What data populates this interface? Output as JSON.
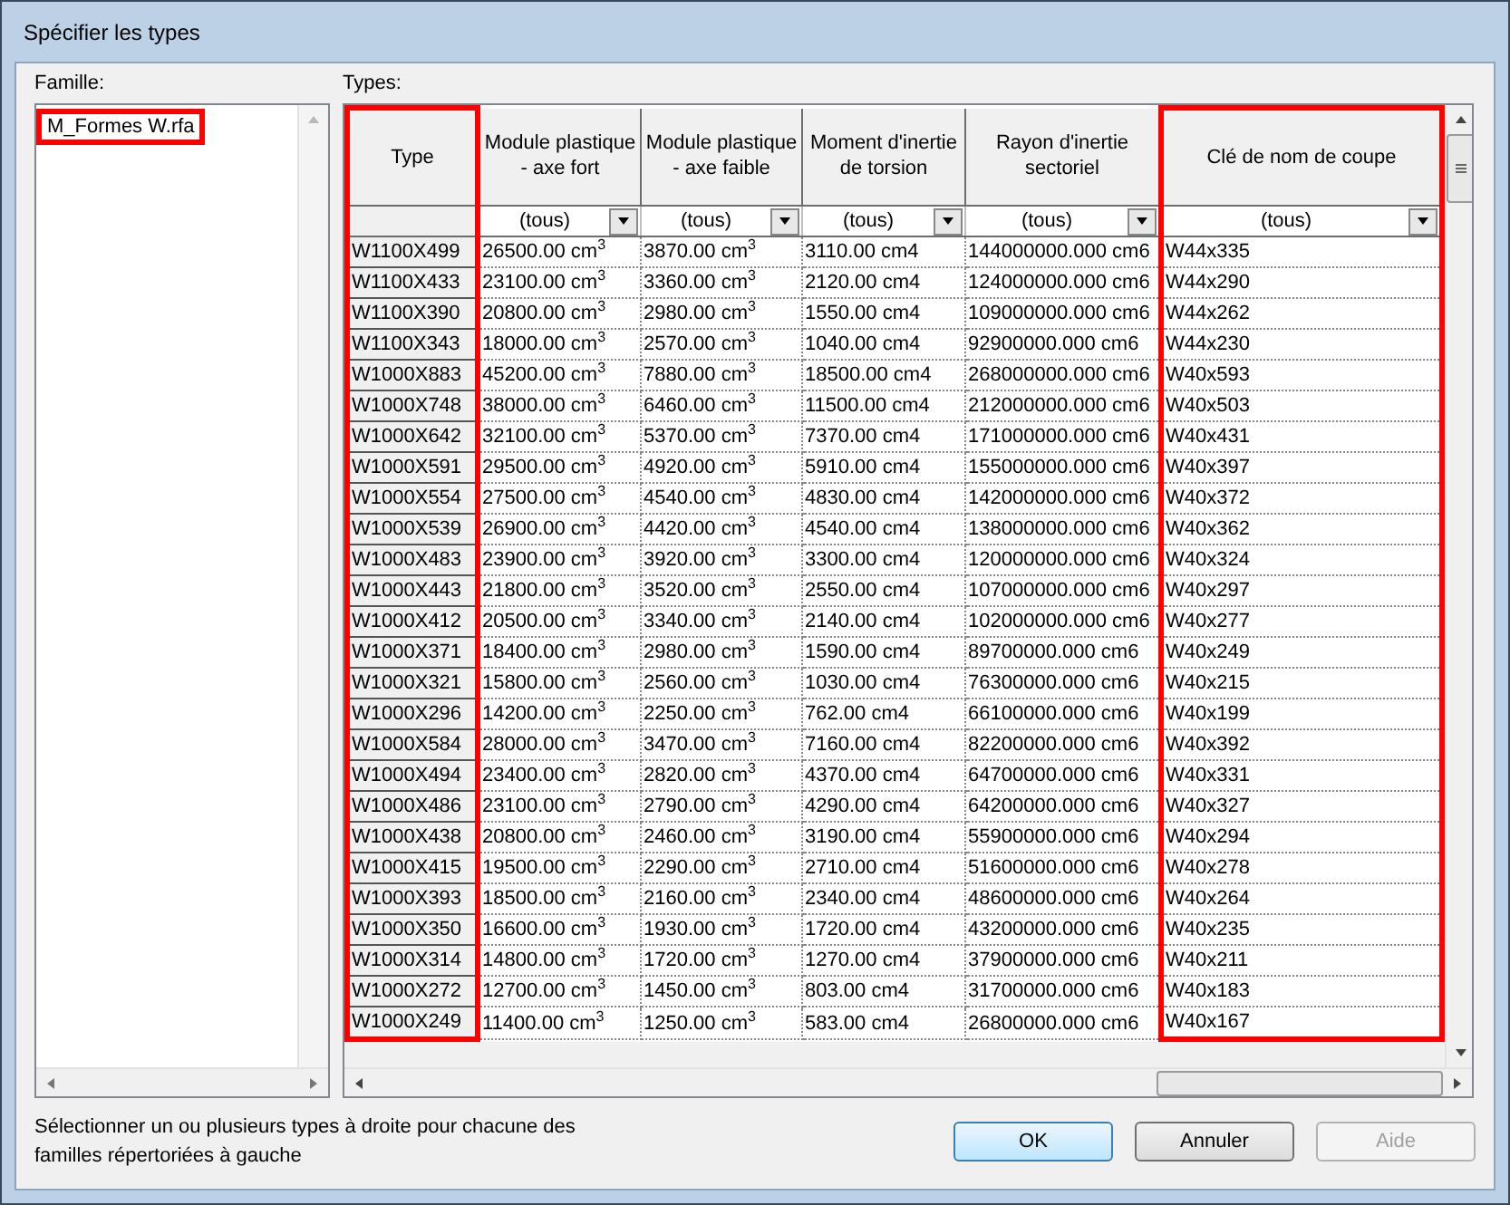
{
  "window": {
    "title": "Spécifier les types"
  },
  "family": {
    "label": "Famille:",
    "items": [
      {
        "name": "M_Formes W.rfa",
        "highlighted": true
      }
    ]
  },
  "types": {
    "label": "Types:",
    "columns": [
      {
        "header": "Type",
        "highlighted": true
      },
      {
        "header": "Module plastique - axe fort",
        "filter": "(tous)",
        "highlighted": false
      },
      {
        "header": "Module plastique - axe faible",
        "filter": "(tous)",
        "highlighted": false
      },
      {
        "header": "Moment d'inertie de torsion",
        "filter": "(tous)",
        "highlighted": false
      },
      {
        "header": "Rayon d'inertie sectoriel",
        "filter": "(tous)",
        "highlighted": false
      },
      {
        "header": "Clé de nom de coupe",
        "filter": "(tous)",
        "highlighted": true
      }
    ],
    "rows": [
      [
        "W1100X499",
        "26500.00 cm$^{3}$",
        "3870.00 cm$^{3}$",
        "3110.00 cm4",
        "144000000.000 cm6",
        "W44x335"
      ],
      [
        "W1100X433",
        "23100.00 cm$^{3}$",
        "3360.00 cm$^{3}$",
        "2120.00 cm4",
        "124000000.000 cm6",
        "W44x290"
      ],
      [
        "W1100X390",
        "20800.00 cm$^{3}$",
        "2980.00 cm$^{3}$",
        "1550.00 cm4",
        "109000000.000 cm6",
        "W44x262"
      ],
      [
        "W1100X343",
        "18000.00 cm$^{3}$",
        "2570.00 cm$^{3}$",
        "1040.00 cm4",
        "92900000.000 cm6",
        "W44x230"
      ],
      [
        "W1000X883",
        "45200.00 cm$^{3}$",
        "7880.00 cm$^{3}$",
        "18500.00 cm4",
        "268000000.000 cm6",
        "W40x593"
      ],
      [
        "W1000X748",
        "38000.00 cm$^{3}$",
        "6460.00 cm$^{3}$",
        "11500.00 cm4",
        "212000000.000 cm6",
        "W40x503"
      ],
      [
        "W1000X642",
        "32100.00 cm$^{3}$",
        "5370.00 cm$^{3}$",
        "7370.00 cm4",
        "171000000.000 cm6",
        "W40x431"
      ],
      [
        "W1000X591",
        "29500.00 cm$^{3}$",
        "4920.00 cm$^{3}$",
        "5910.00 cm4",
        "155000000.000 cm6",
        "W40x397"
      ],
      [
        "W1000X554",
        "27500.00 cm$^{3}$",
        "4540.00 cm$^{3}$",
        "4830.00 cm4",
        "142000000.000 cm6",
        "W40x372"
      ],
      [
        "W1000X539",
        "26900.00 cm$^{3}$",
        "4420.00 cm$^{3}$",
        "4540.00 cm4",
        "138000000.000 cm6",
        "W40x362"
      ],
      [
        "W1000X483",
        "23900.00 cm$^{3}$",
        "3920.00 cm$^{3}$",
        "3300.00 cm4",
        "120000000.000 cm6",
        "W40x324"
      ],
      [
        "W1000X443",
        "21800.00 cm$^{3}$",
        "3520.00 cm$^{3}$",
        "2550.00 cm4",
        "107000000.000 cm6",
        "W40x297"
      ],
      [
        "W1000X412",
        "20500.00 cm$^{3}$",
        "3340.00 cm$^{3}$",
        "2140.00 cm4",
        "102000000.000 cm6",
        "W40x277"
      ],
      [
        "W1000X371",
        "18400.00 cm$^{3}$",
        "2980.00 cm$^{3}$",
        "1590.00 cm4",
        "89700000.000 cm6",
        "W40x249"
      ],
      [
        "W1000X321",
        "15800.00 cm$^{3}$",
        "2560.00 cm$^{3}$",
        "1030.00 cm4",
        "76300000.000 cm6",
        "W40x215"
      ],
      [
        "W1000X296",
        "14200.00 cm$^{3}$",
        "2250.00 cm$^{3}$",
        "762.00 cm4",
        "66100000.000 cm6",
        "W40x199"
      ],
      [
        "W1000X584",
        "28000.00 cm$^{3}$",
        "3470.00 cm$^{3}$",
        "7160.00 cm4",
        "82200000.000 cm6",
        "W40x392"
      ],
      [
        "W1000X494",
        "23400.00 cm$^{3}$",
        "2820.00 cm$^{3}$",
        "4370.00 cm4",
        "64700000.000 cm6",
        "W40x331"
      ],
      [
        "W1000X486",
        "23100.00 cm$^{3}$",
        "2790.00 cm$^{3}$",
        "4290.00 cm4",
        "64200000.000 cm6",
        "W40x327"
      ],
      [
        "W1000X438",
        "20800.00 cm$^{3}$",
        "2460.00 cm$^{3}$",
        "3190.00 cm4",
        "55900000.000 cm6",
        "W40x294"
      ],
      [
        "W1000X415",
        "19500.00 cm$^{3}$",
        "2290.00 cm$^{3}$",
        "2710.00 cm4",
        "51600000.000 cm6",
        "W40x278"
      ],
      [
        "W1000X393",
        "18500.00 cm$^{3}$",
        "2160.00 cm$^{3}$",
        "2340.00 cm4",
        "48600000.000 cm6",
        "W40x264"
      ],
      [
        "W1000X350",
        "16600.00 cm$^{3}$",
        "1930.00 cm$^{3}$",
        "1720.00 cm4",
        "43200000.000 cm6",
        "W40x235"
      ],
      [
        "W1000X314",
        "14800.00 cm$^{3}$",
        "1720.00 cm$^{3}$",
        "1270.00 cm4",
        "37900000.000 cm6",
        "W40x211"
      ],
      [
        "W1000X272",
        "12700.00 cm$^{3}$",
        "1450.00 cm$^{3}$",
        "803.00 cm4",
        "31700000.000 cm6",
        "W40x183"
      ],
      [
        "W1000X249",
        "11400.00 cm$^{3}$",
        "1250.00 cm$^{3}$",
        "583.00 cm4",
        "26800000.000 cm6",
        "W40x167"
      ]
    ]
  },
  "hint": "Sélectionner un ou plusieurs types à droite pour chacune des familles répertoriées à gauche",
  "buttons": [
    {
      "label": "OK",
      "default": true,
      "disabled": false
    },
    {
      "label": "Annuler",
      "default": false,
      "disabled": false
    },
    {
      "label": "Aide",
      "default": false,
      "disabled": true
    }
  ]
}
